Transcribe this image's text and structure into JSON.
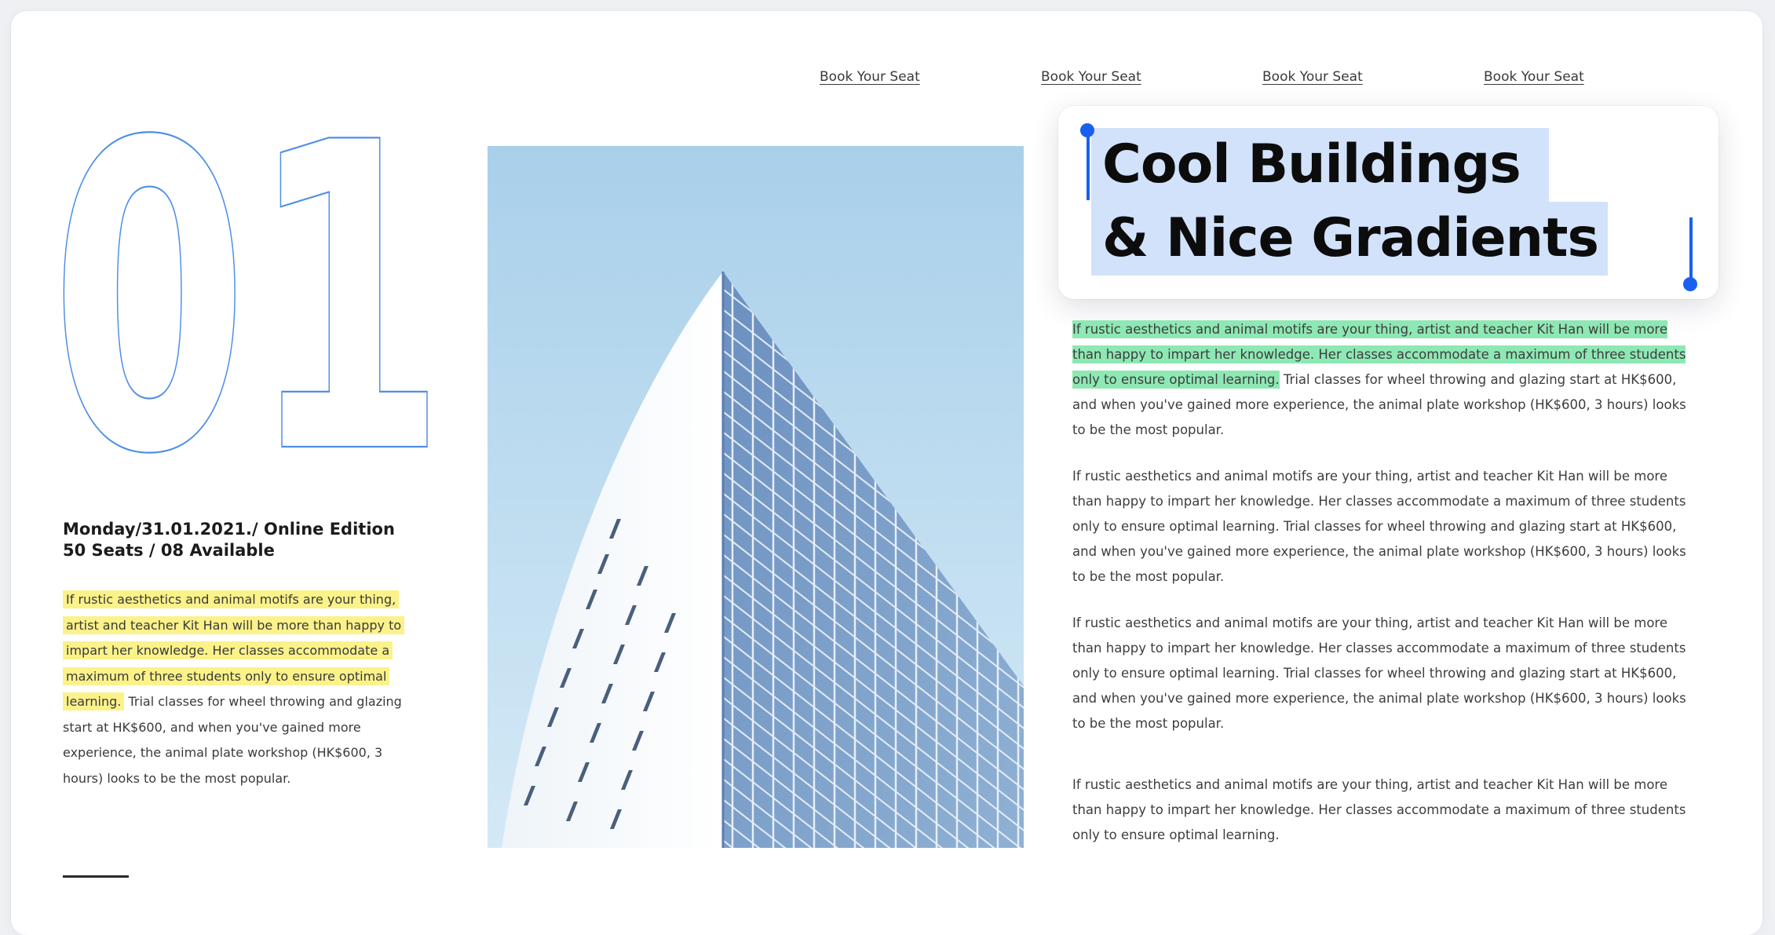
{
  "nav": {
    "links": [
      "Book Your Seat",
      "Book Your Seat",
      "Book Your Seat",
      "Book Your Seat"
    ]
  },
  "hero": {
    "number": "01",
    "title_line1": "Cool Buildings",
    "title_line2": "& Nice Gradients"
  },
  "event": {
    "date_line": "Monday/31.01.2021./ Online Edition",
    "seats_line": "50 Seats / 08 Available"
  },
  "left_copy": {
    "highlighted": "If rustic aesthetics and animal motifs are your thing, artist and teacher Kit Han will be more than happy to impart her knowledge. Her classes accommodate a maximum of three students only to ensure optimal learning.",
    "rest": "Trial classes for wheel throwing and glazing start at HK$600, and when you've gained more experience, the animal plate workshop (HK$600, 3 hours) looks to be the most popular."
  },
  "paragraphs": {
    "p1_highlighted": "If rustic aesthetics and animal motifs are your thing, artist and teacher Kit Han will be more than happy to impart her knowledge. Her classes accommodate a maximum of three students only to ensure optimal learning.",
    "p1_rest": "Trial classes for wheel throwing and glazing start at HK$600, and when you've gained more experience, the animal plate workshop (HK$600, 3 hours) looks to be the most popular.",
    "p2": "If rustic aesthetics and animal motifs are your thing, artist and teacher Kit Han will be more than happy to impart her knowledge. Her classes accommodate a maximum of three students only to ensure optimal learning. Trial classes for wheel throwing and glazing start at HK$600, and when you've gained more experience, the animal plate workshop (HK$600, 3 hours) looks to be the most popular.",
    "p3": "If rustic aesthetics and animal motifs are your thing, artist and teacher Kit Han will be more than happy to impart her knowledge. Her classes accommodate a maximum of three students only to ensure optimal learning. Trial classes for wheel throwing and glazing start at HK$600, and when you've gained more experience, the animal plate workshop (HK$600, 3 hours) looks to be the most popular.",
    "p4": "If rustic aesthetics and animal motifs are your thing, artist and teacher Kit Han will be more than happy to impart her knowledge. Her classes accommodate a maximum of three students only to ensure optimal learning."
  },
  "colors": {
    "number_outline": "#4f8fe6",
    "selection_caret": "#1a5ff0",
    "selection_fill": "#d2e2fb",
    "highlight_yellow": "#fbf28a",
    "highlight_green": "#8ee8b4"
  }
}
